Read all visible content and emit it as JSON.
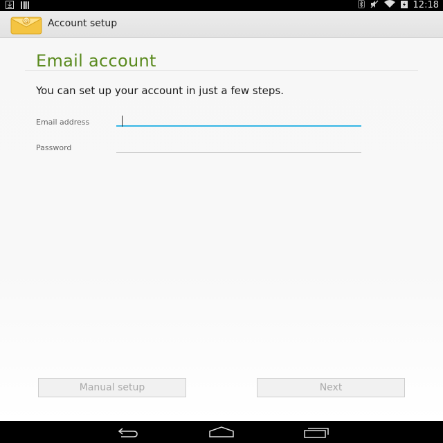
{
  "status_bar": {
    "time": "12:18",
    "left_icons": [
      "download-icon",
      "barcode-icon"
    ],
    "right_icons": [
      "bluetooth-icon",
      "mute-icon",
      "wifi-icon",
      "battery-icon"
    ]
  },
  "action_bar": {
    "title": "Account setup",
    "app_icon": "email-envelope-icon"
  },
  "page": {
    "title": "Email account",
    "intro": "You can set up your account in just a few steps.",
    "email_label": "Email address",
    "email_value": "",
    "password_label": "Password",
    "password_value": ""
  },
  "buttons": {
    "manual_setup": "Manual setup",
    "next": "Next"
  },
  "nav_bar": {
    "icons": [
      "back-icon",
      "home-icon",
      "recent-apps-icon"
    ]
  },
  "colors": {
    "title_green": "#5a8a1e",
    "focus_blue": "#33b5e5"
  }
}
